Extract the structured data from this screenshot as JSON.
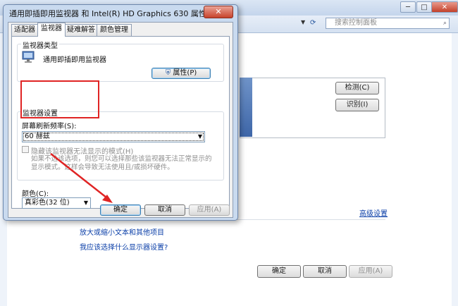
{
  "background_window": {
    "search_placeholder": "搜索控制面板",
    "detect_button": "检测(C)",
    "identify_button": "识别(I)",
    "advanced_settings_link": "高级设置",
    "links": [
      "放大或缩小文本和其他项目",
      "我应该选择什么显示器设置?"
    ],
    "ok_button": "确定",
    "cancel_button": "取消",
    "apply_button": "应用(A)"
  },
  "dialog": {
    "title": "通用即插即用监视器 和 Intel(R) HD Graphics 630 属性",
    "close_symbol": "✕",
    "tabs": [
      "适配器",
      "监视器",
      "疑难解答",
      "颜色管理"
    ],
    "active_tab": "监视器",
    "monitor_type_label": "监视器类型",
    "monitor_name": "通用即插即用监视器",
    "properties_button": "属性(P)",
    "monitor_settings_label": "监视器设置",
    "refresh_rate_label": "屏幕刷新频率(S):",
    "refresh_rate_value": "60 赫兹",
    "hide_modes_checkbox": "隐藏该监视器无法显示的模式(H)",
    "hide_modes_note": "如果不选该选项，则您可以选择那些该监视器无法正常显示的显示模式。这样会导致无法使用且/或损坏硬件。",
    "color_label": "颜色(C):",
    "color_value": "真彩色(32 位)",
    "ok_button": "确定",
    "cancel_button": "取消",
    "apply_button": "应用(A)"
  },
  "colors": {
    "annotation": "#e02424",
    "link": "#0b3fa8"
  }
}
